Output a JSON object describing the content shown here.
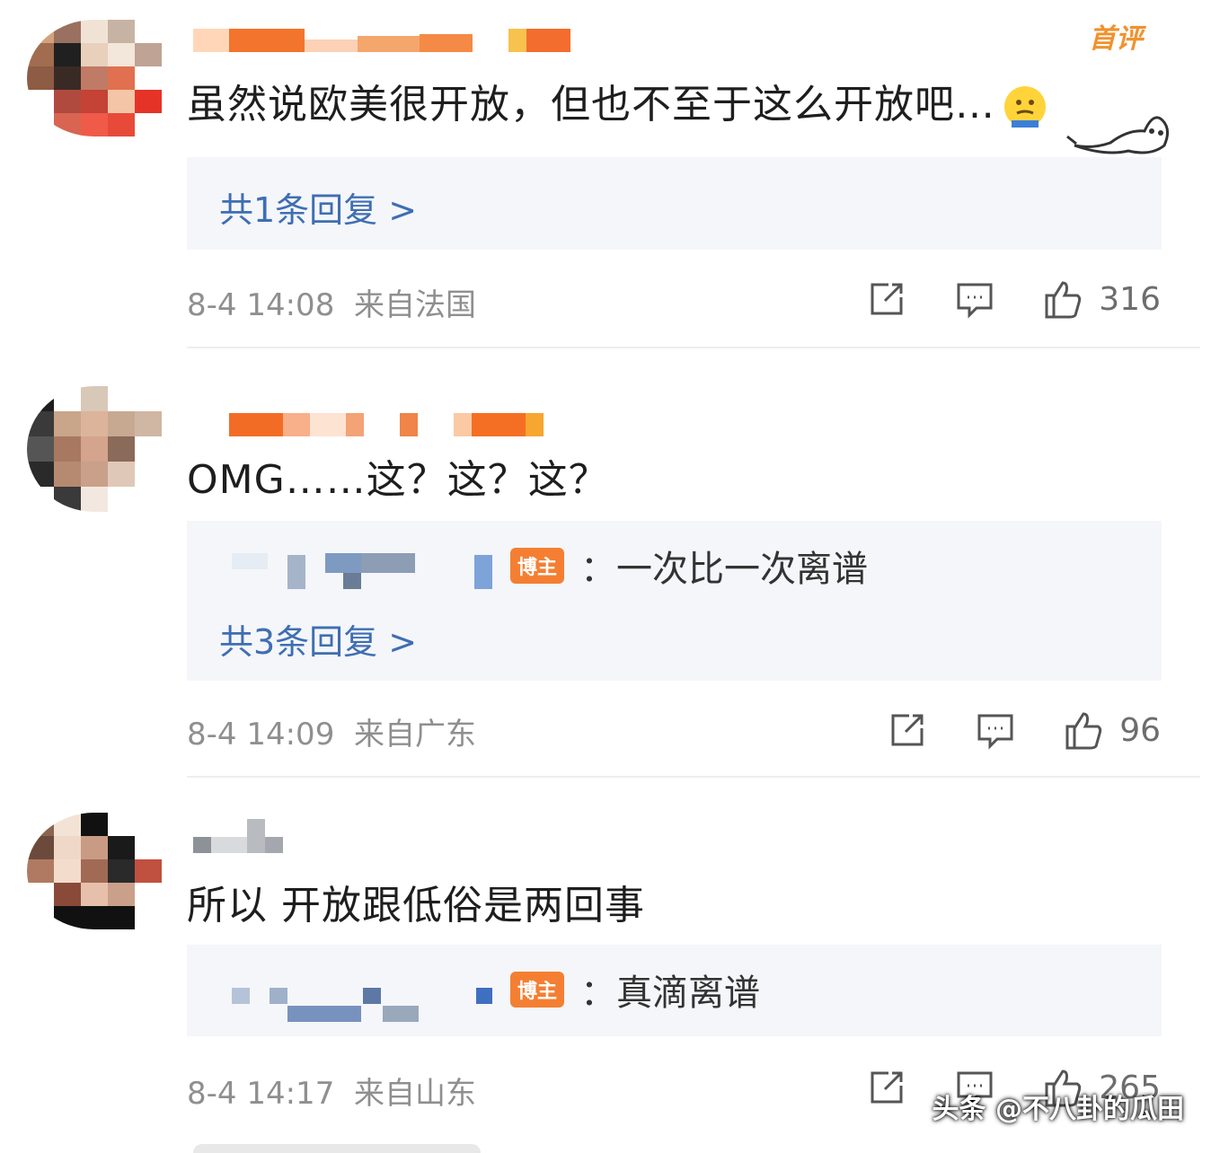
{
  "comments": [
    {
      "first_badge": "首评",
      "text": "虽然说欧美很开放，但也不至于这么开放吧…",
      "reply_count_label": "共1条回复 >",
      "time": "8-4 14:08",
      "location": "来自法国",
      "likes": "316"
    },
    {
      "text": "OMG……这？这？这？",
      "sub_reply": {
        "badge": "博主",
        "text": "：一次比一次离谱"
      },
      "reply_count_label": "共3条回复 >",
      "time": "8-4 14:09",
      "location": "来自广东",
      "likes": "96"
    },
    {
      "text": "所以 开放跟低俗是两回事",
      "sub_reply": {
        "badge": "博主",
        "text": "：真滴离谱"
      },
      "time": "8-4 14:17",
      "location": "来自山东",
      "likes": "265"
    }
  ],
  "watermark": "头条 @不八卦的瓜田",
  "icons": {
    "share": "share-icon",
    "comment": "comment-icon",
    "like": "thumbs-up-icon",
    "emoji": "shrug-emoji-icon",
    "sticker": "dog-sticker-icon"
  },
  "colors": {
    "reply_link": "#3f6eb3",
    "bozhu_badge": "#f47f32",
    "first_badge": "#f0922e",
    "meta": "#8f8f8f"
  }
}
